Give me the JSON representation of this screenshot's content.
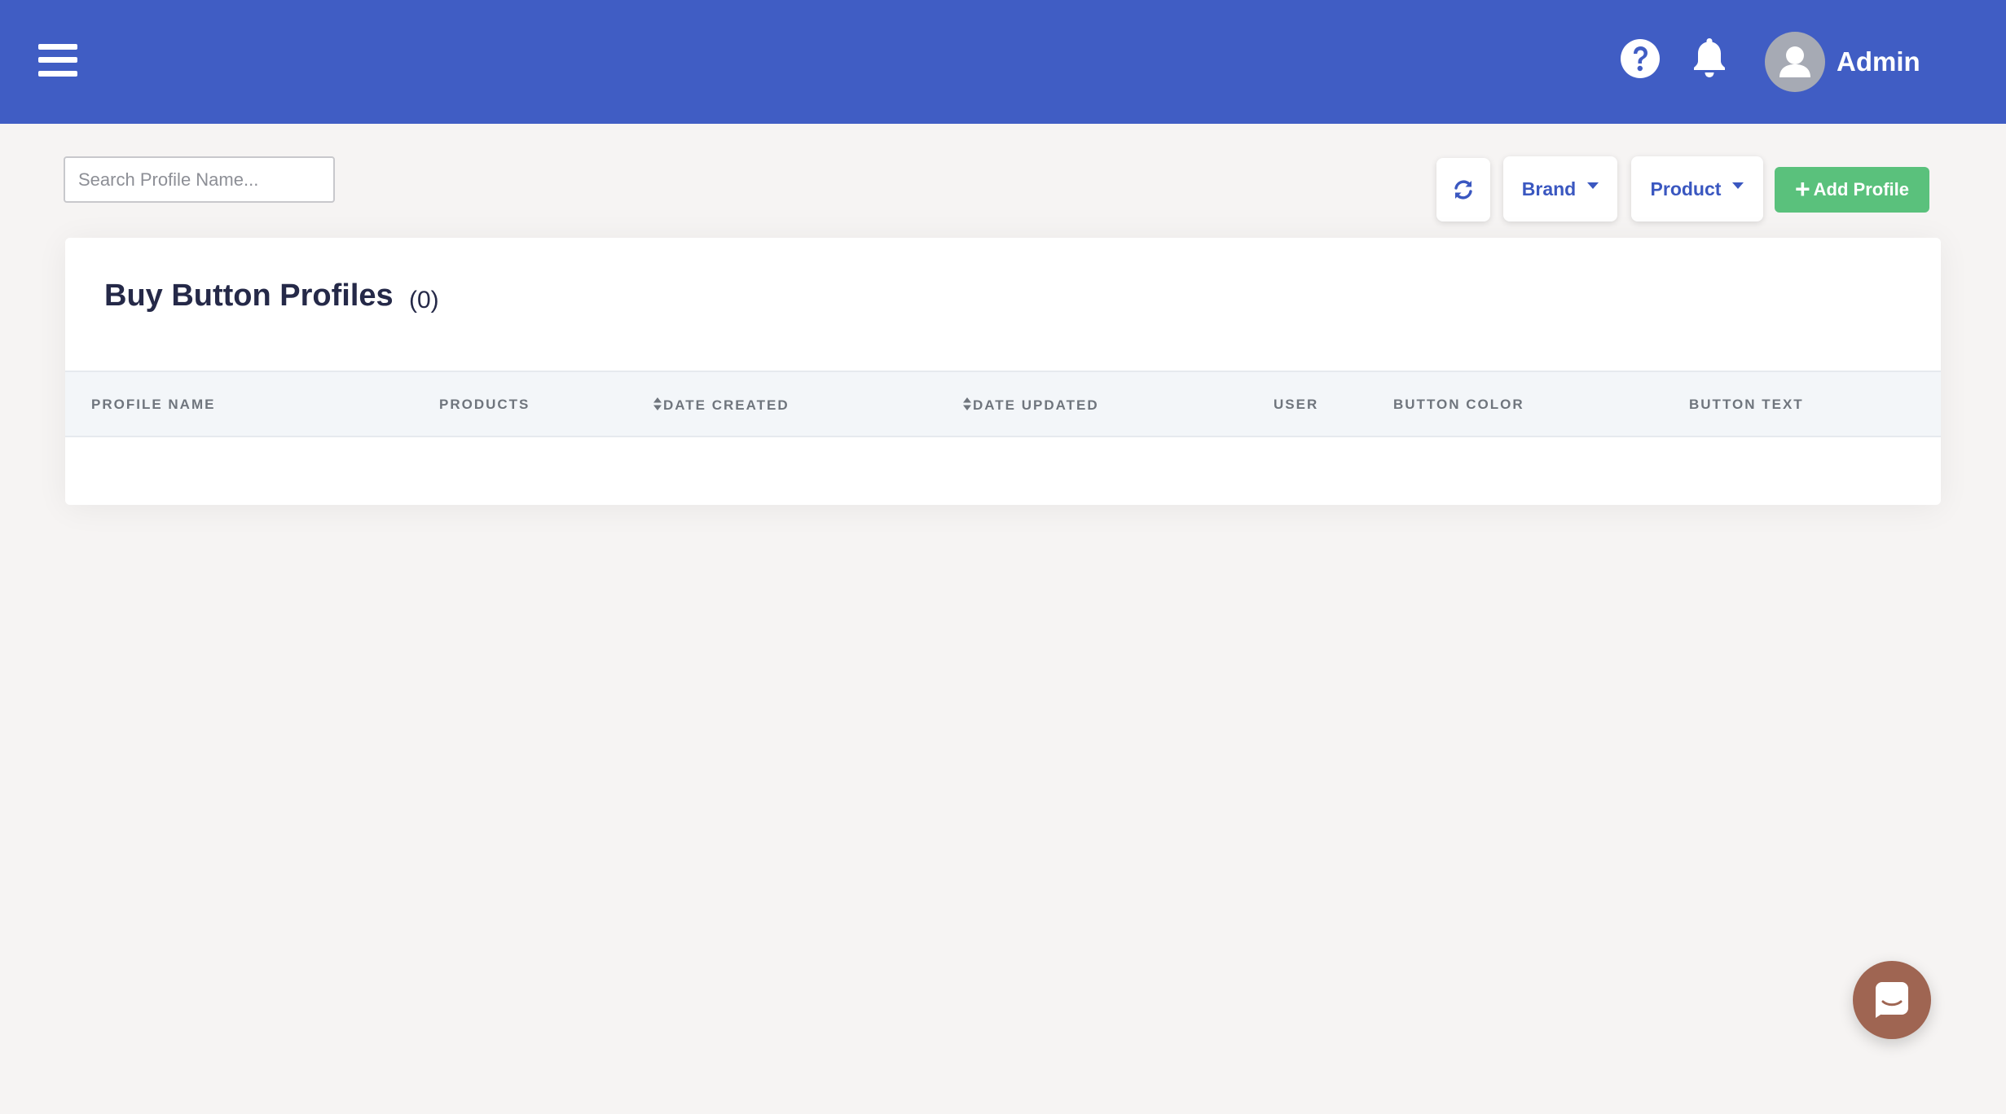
{
  "header": {
    "user_name": "Admin",
    "colors": {
      "bar": "#405dc4"
    }
  },
  "toolbar": {
    "search_placeholder": "Search Profile Name...",
    "search_value": "",
    "brand_label": "Brand",
    "product_label": "Product",
    "add_label": "Add Profile",
    "add_color": "#5ac17c"
  },
  "card": {
    "title": "Buy Button Profiles",
    "count": "(0)"
  },
  "table": {
    "columns": [
      {
        "label": "PROFILE NAME",
        "sortable": false
      },
      {
        "label": "PRODUCTS",
        "sortable": false
      },
      {
        "label": "DATE CREATED",
        "sortable": true
      },
      {
        "label": "DATE UPDATED",
        "sortable": true
      },
      {
        "label": "USER",
        "sortable": false
      },
      {
        "label": "BUTTON COLOR",
        "sortable": false
      },
      {
        "label": "BUTTON TEXT",
        "sortable": false
      }
    ],
    "rows": []
  },
  "icons": {
    "menu": "hamburger-icon",
    "help": "help-icon",
    "notifications": "bell-icon",
    "avatar": "user-avatar-icon",
    "refresh": "refresh-icon",
    "sort": "sort-icon",
    "chat": "chat-icon"
  }
}
